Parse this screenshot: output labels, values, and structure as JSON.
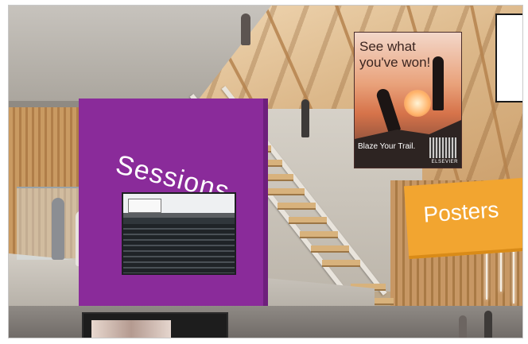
{
  "scene": {
    "sessions_sign": {
      "label": "Sessions",
      "color": "#8a2b9a"
    },
    "posters_sign": {
      "label": "Posters",
      "color": "#f2a530"
    },
    "ad_poster": {
      "headline": "See what you've won!",
      "tagline": "Blaze Your Trail.",
      "brand": "ELSEVIER"
    }
  }
}
